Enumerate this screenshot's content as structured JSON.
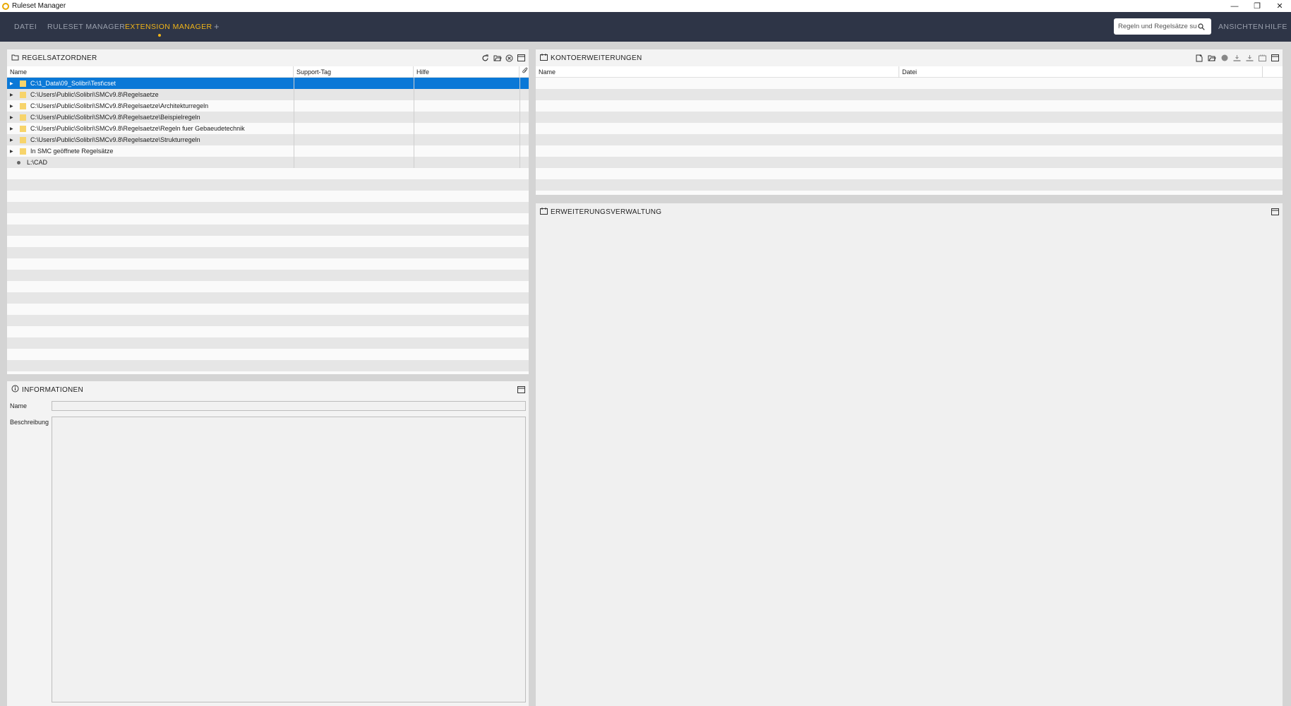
{
  "window": {
    "title": "Ruleset Manager",
    "minimize_glyph": "—",
    "restore_glyph": "❐",
    "close_glyph": "✕"
  },
  "nav": {
    "items": [
      "DATEI",
      "RULESET MANAGER",
      "EXTENSION MANAGER",
      "+"
    ],
    "active": "EXTENSION MANAGER",
    "search_placeholder": "Regeln und Regelsätze suchen",
    "right_items": [
      "ANSICHTEN",
      "HILFE"
    ]
  },
  "colors": {
    "navbar": "#2e3547",
    "accent": "#f0b418",
    "selection": "#0a78d7",
    "folder": "#f7d46b"
  },
  "regelsatzordner": {
    "title": "REGELSATZORDNER",
    "icon": "folder-open-icon",
    "tools": [
      "refresh-icon",
      "open-folder-icon",
      "remove-icon",
      "maximize-icon"
    ],
    "columns": [
      "Name",
      "Support-Tag",
      "Hilfe",
      ""
    ],
    "attach_icon": "paperclip-icon",
    "rows": [
      {
        "name": "C:\\1_Data\\09_Solibri\\Test\\cset",
        "type": "folder",
        "selected": true
      },
      {
        "name": "C:\\Users\\Public\\Solibri\\SMCv9.8\\Regelsaetze",
        "type": "folder"
      },
      {
        "name": "C:\\Users\\Public\\Solibri\\SMCv9.8\\Regelsaetze\\Architekturregeln",
        "type": "folder"
      },
      {
        "name": "C:\\Users\\Public\\Solibri\\SMCv9.8\\Regelsaetze\\Beispielregeln",
        "type": "folder"
      },
      {
        "name": "C:\\Users\\Public\\Solibri\\SMCv9.8\\Regelsaetze\\Regeln fuer Gebaeudetechnik",
        "type": "folder"
      },
      {
        "name": "C:\\Users\\Public\\Solibri\\SMCv9.8\\Regelsaetze\\Strukturregeln",
        "type": "folder"
      },
      {
        "name": "In SMC geöffnete Regelsätze",
        "type": "folder"
      },
      {
        "name": "L:\\CAD",
        "type": "bullet"
      }
    ]
  },
  "informationen": {
    "title": "INFORMATIONEN",
    "icon": "info-icon",
    "name_label": "Name",
    "name_value": "",
    "beschreibung_label": "Beschreibung",
    "beschreibung_value": ""
  },
  "kontoerweiterungen": {
    "title": "KONTOERWEITERUNGEN",
    "icon": "calendar-icon",
    "tools": [
      "new-file-icon",
      "open-folder-icon",
      "globe-icon",
      "download-icon",
      "download-all-icon",
      "package-icon",
      "maximize-icon"
    ],
    "columns": [
      "Name",
      "Datei"
    ]
  },
  "erweiterungsverwaltung": {
    "title": "ERWEITERUNGSVERWALTUNG",
    "icon": "calendar-icon",
    "tools": [
      "maximize-icon"
    ]
  }
}
